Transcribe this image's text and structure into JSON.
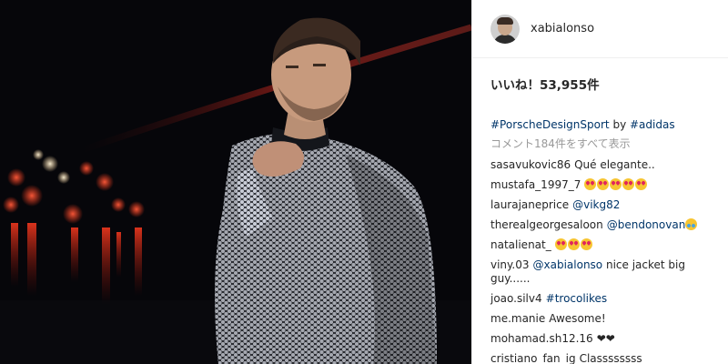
{
  "post": {
    "username": "xabialonso",
    "likes_text": "いいね！53,955件",
    "caption": {
      "tag1": "#PorscheDesignSport",
      "by": "by",
      "tag2": "#adidas"
    },
    "view_all_comments": "コメント184件をすべて表示"
  },
  "comments": [
    {
      "user": "sasavukovic86",
      "text": "Qué elegante..",
      "mention": "",
      "emoji_count": 0
    },
    {
      "user": "mustafa_1997_7",
      "text": "",
      "mention": "",
      "emoji_count": 5,
      "emoji_icon": "heart-eyes-emoji"
    },
    {
      "user": "laurajaneprice",
      "text": "",
      "mention": "@vikg82",
      "emoji_count": 0
    },
    {
      "user": "therealgeorgesaloon",
      "text": "",
      "mention": "@bendonovan",
      "emoji_count": 1,
      "emoji_icon": "tears-of-joy-emoji"
    },
    {
      "user": "natalienat_",
      "text": "",
      "mention": "",
      "emoji_count": 3,
      "emoji_icon": "heart-eyes-emoji"
    },
    {
      "user": "viny.03",
      "text": "nice jacket big guy......",
      "mention": "@xabialonso",
      "emoji_count": 0
    },
    {
      "user": "joao.silv4",
      "text": "",
      "mention": "#trocolikes",
      "emoji_count": 0
    },
    {
      "user": "me.manie",
      "text": "Awesome!",
      "mention": "",
      "emoji_count": 0
    },
    {
      "user": "mohamad.sh12.16",
      "text": "❤❤",
      "mention": "",
      "emoji_count": 0
    },
    {
      "user": "cristiano_fan_ig",
      "text": "Classssssss",
      "mention": "",
      "emoji_count": 0
    }
  ],
  "colors": {
    "link": "#003569",
    "muted": "#999999",
    "text": "#262626",
    "border": "#efefef"
  }
}
